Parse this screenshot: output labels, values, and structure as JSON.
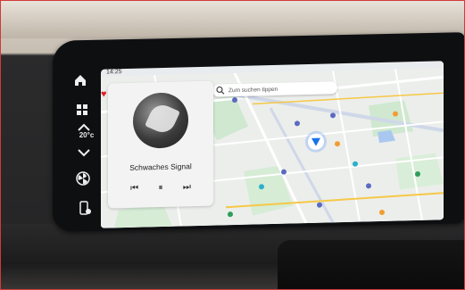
{
  "status_bar": {
    "time": "14:25"
  },
  "search": {
    "placeholder": "Zum suchen tippen"
  },
  "media": {
    "track_title": "Schwaches Signal",
    "favorite_icon": "heart-icon",
    "controls": [
      "previous-icon",
      "pause-icon",
      "next-icon"
    ]
  },
  "climate": {
    "temperature": "20°c"
  },
  "side_keys": [
    "home-icon",
    "apps-grid-icon",
    "up-icon",
    "down-icon",
    "fan-icon",
    "phone-settings-icon"
  ],
  "colors": {
    "accent_heart": "#e11d2a",
    "location_blue": "#1a73e8",
    "park_green": "#c8e6c9",
    "road_yellow": "#f6c846",
    "frame_red": "#d23a3a"
  }
}
